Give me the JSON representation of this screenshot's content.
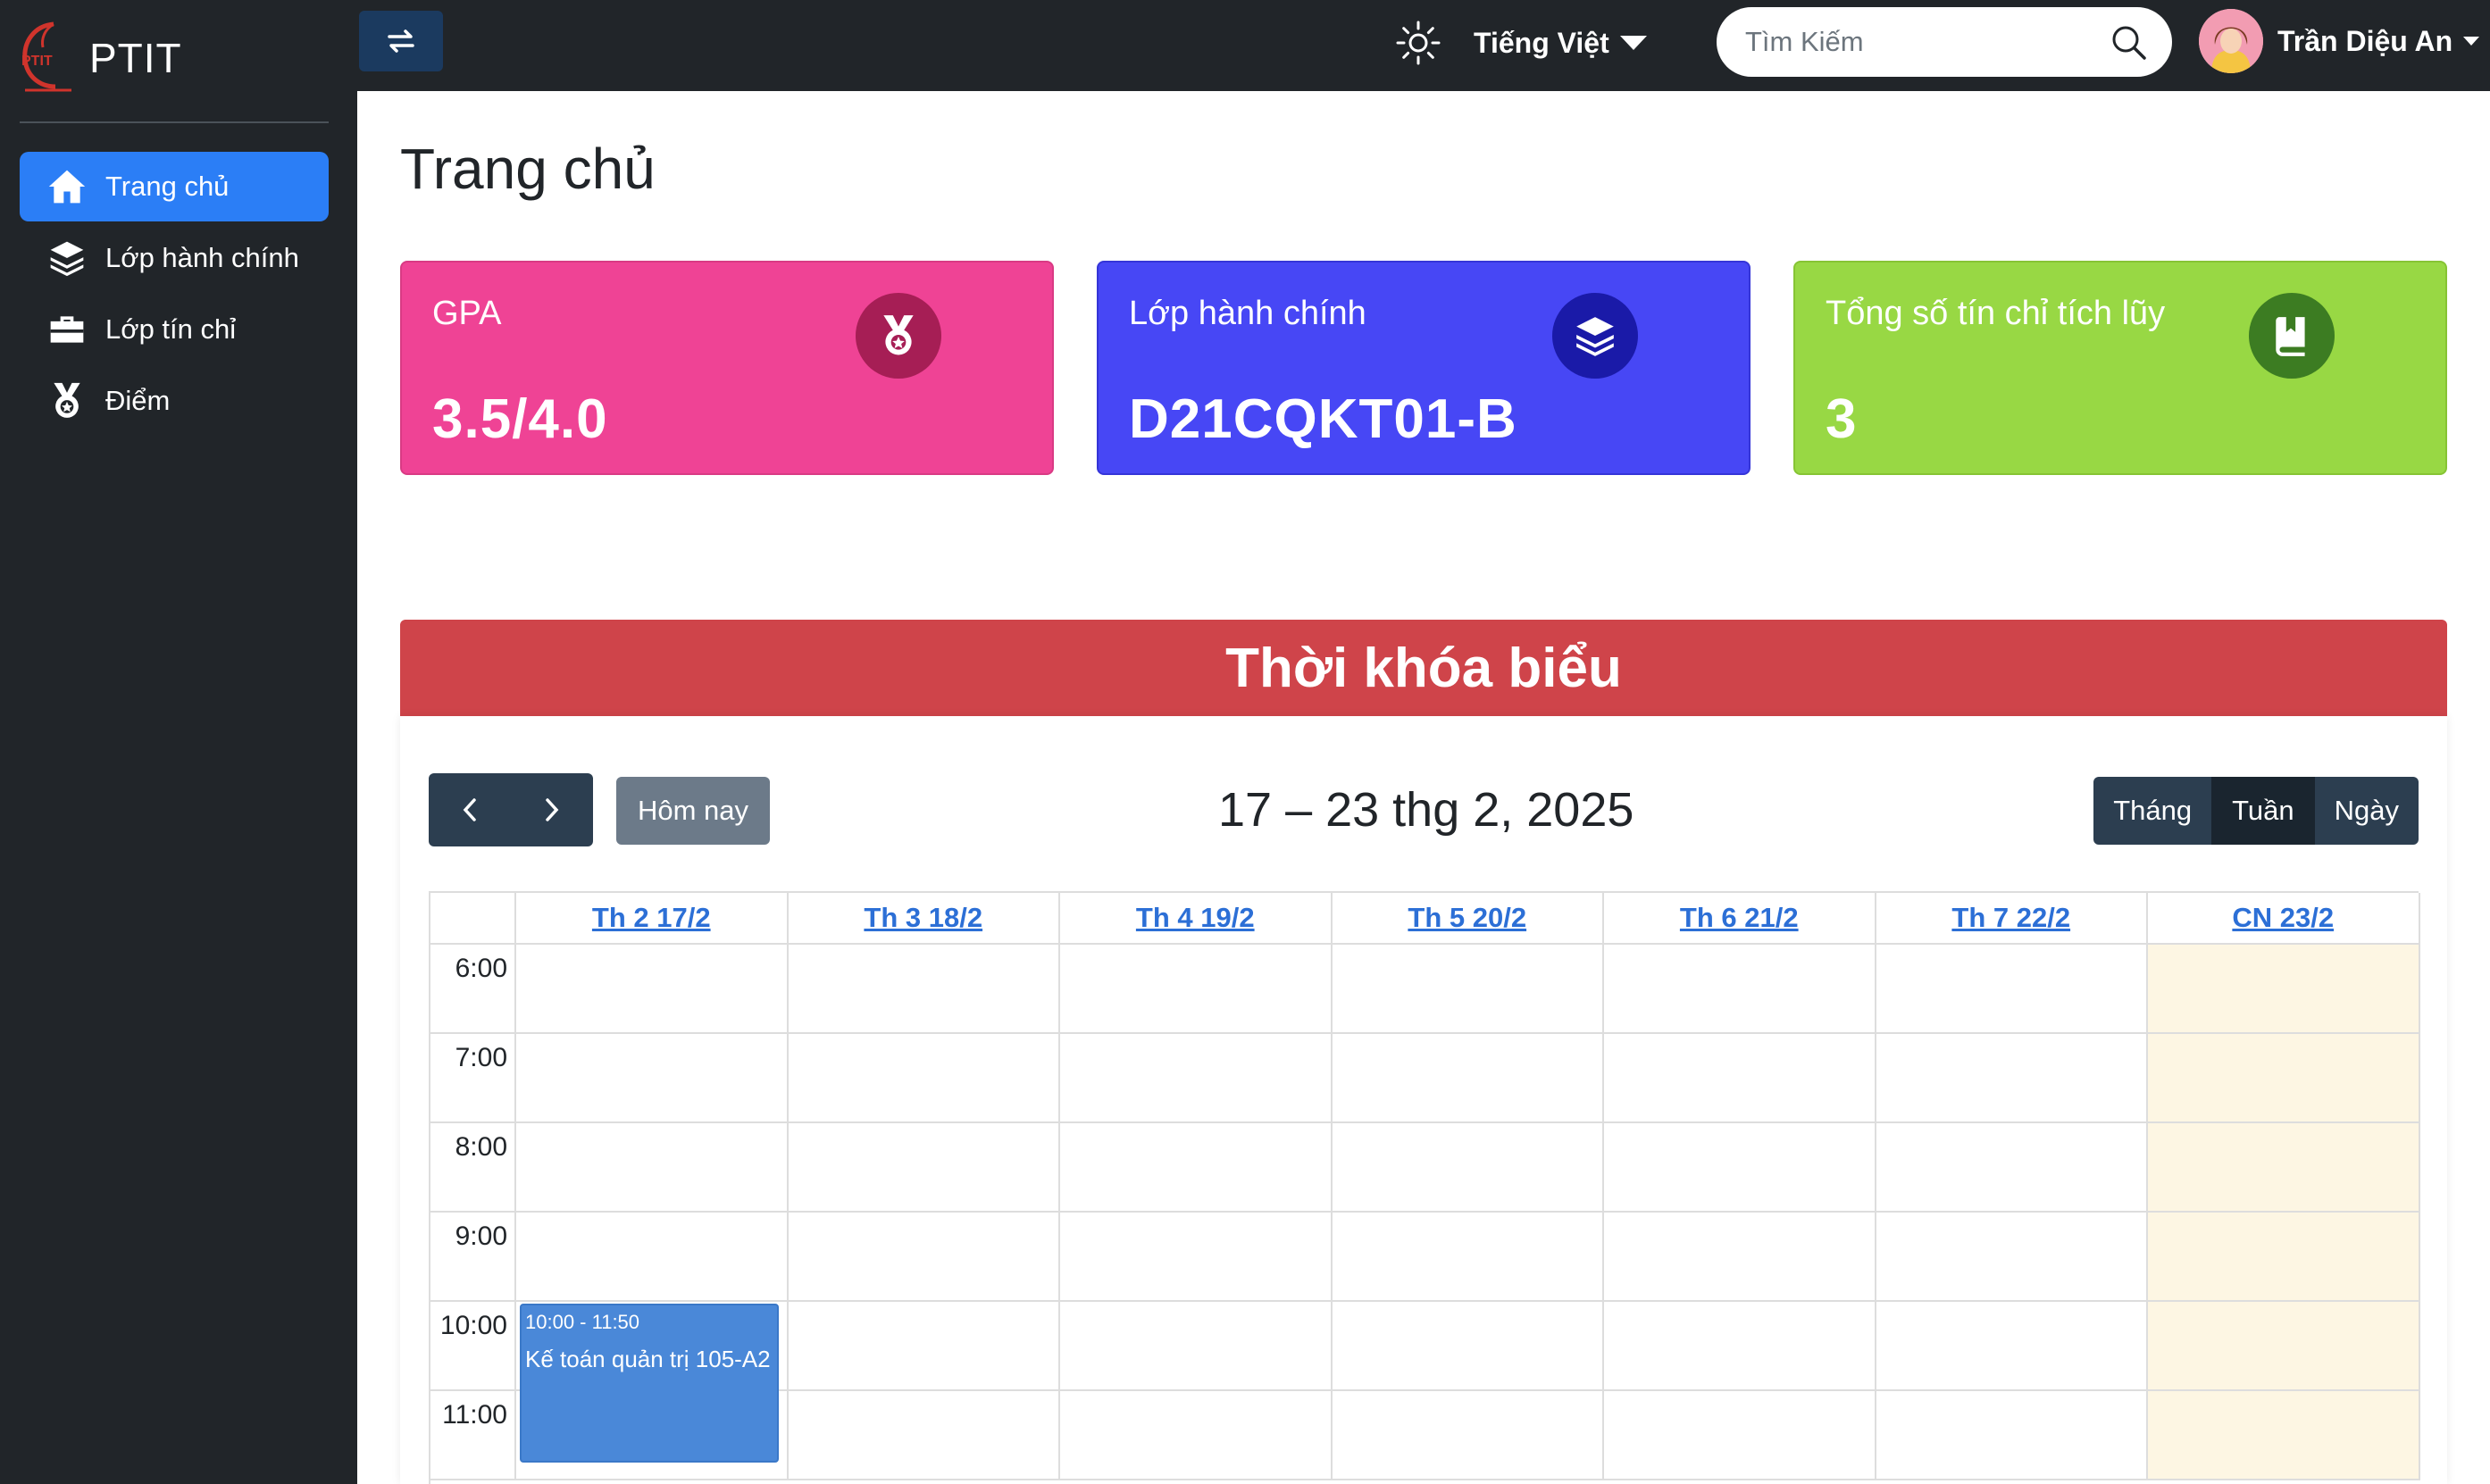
{
  "brand": {
    "name": "PTIT",
    "logo_text": "PTIT"
  },
  "sidebar": {
    "items": [
      {
        "label": "Trang chủ",
        "icon": "home-icon",
        "active": true
      },
      {
        "label": "Lớp hành chính",
        "icon": "layers-icon",
        "active": false
      },
      {
        "label": "Lớp tín chỉ",
        "icon": "briefcase-icon",
        "active": false
      },
      {
        "label": "Điểm",
        "icon": "medal-icon",
        "active": false
      }
    ]
  },
  "topbar": {
    "toggle_icon": "swap-arrows-icon",
    "theme_icon": "sun-icon",
    "language": "Tiếng Việt",
    "search_placeholder": "Tìm Kiếm",
    "user_name": "Trần Diệu An"
  },
  "main": {
    "title": "Trang chủ",
    "cards": [
      {
        "label": "GPA",
        "value": "3.5/4.0",
        "icon": "medal-icon",
        "color": "#ef4395"
      },
      {
        "label": "Lớp hành chính",
        "value": "D21CQKT01-B",
        "icon": "layers-icon",
        "color": "#4747f5"
      },
      {
        "label": "Tổng số tín chỉ tích lũy",
        "value": "3",
        "icon": "book-icon",
        "color": "#98d844"
      }
    ]
  },
  "schedule": {
    "title": "Thời khóa biểu",
    "today_label": "Hôm nay",
    "range_title": "17 – 23 thg 2, 2025",
    "views": [
      "Tháng",
      "Tuần",
      "Ngày"
    ],
    "active_view": "Tuần",
    "days": [
      "Th 2 17/2",
      "Th 3 18/2",
      "Th 4 19/2",
      "Th 5 20/2",
      "Th 6 21/2",
      "Th 7 22/2",
      "CN 23/2"
    ],
    "times": [
      "6:00",
      "7:00",
      "8:00",
      "9:00",
      "10:00",
      "11:00"
    ],
    "event": {
      "time": "10:00 - 11:50",
      "title": "Kế toán quản trị 105-A2",
      "day": "Th 2 17/2"
    }
  },
  "colors": {
    "sidebar_bg": "#212529",
    "active_nav": "#2b7ef6",
    "schedule_header": "#cf444a",
    "event": "#4a88d8",
    "today_column": "#fdf6e3"
  }
}
